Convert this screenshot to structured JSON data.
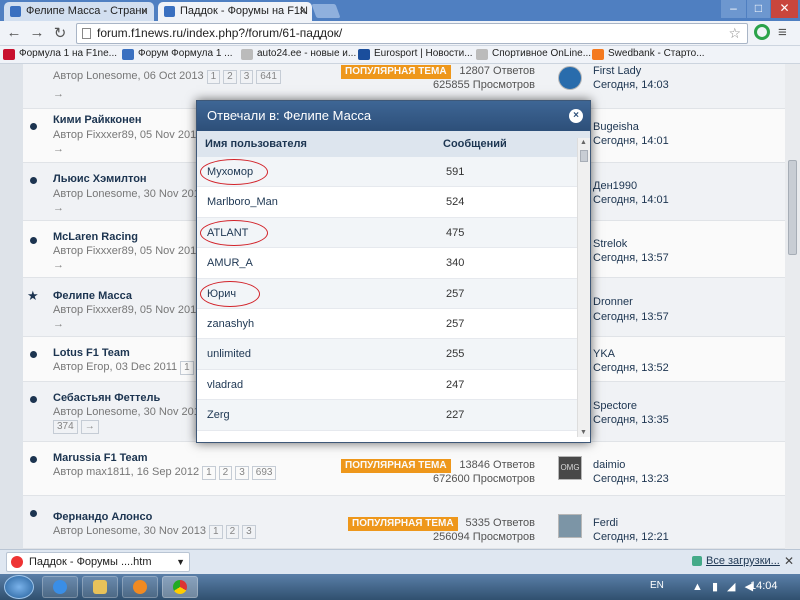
{
  "browser": {
    "tabs": [
      {
        "title": "Фелипе Масса - Страни",
        "active": false
      },
      {
        "title": "Паддок - Форумы на F1N",
        "active": true
      }
    ],
    "window_buttons": {
      "minimize": "–",
      "maximize": "□",
      "close": "✕"
    },
    "nav": {
      "back": "←",
      "forward": "→",
      "reload": "↻"
    },
    "url": "forum.f1news.ru/index.php?/forum/61-паддок/",
    "bookmarks": [
      {
        "label": "Формула 1 на F1ne...",
        "color": "#c8102e"
      },
      {
        "label": "Форум Формула 1 ...",
        "color": "#3a70c0"
      },
      {
        "label": "auto24.ee - новые и...",
        "color": "#999999"
      },
      {
        "label": "Eurosport | Новости...",
        "color": "#1a4e9c"
      },
      {
        "label": "Спортивное OnLine...",
        "color": "#999999"
      },
      {
        "label": "Swedbank - Старто...",
        "color": "#f47a20"
      }
    ]
  },
  "topics": [
    {
      "title": "",
      "author": "Автор Lonesome, 06 Oct 2013",
      "pages": [
        "1",
        "2",
        "3",
        "641"
      ],
      "arrow": "→",
      "popular": "ПОПУЛЯРНАЯ ТЕМА",
      "replies": "12807 Ответов",
      "views": "625855 Просмотров",
      "last_user": "First Lady",
      "last_date": "Сегодня, 14:03"
    },
    {
      "title": "Кими Райкконен",
      "author": "Автор Fixxxer89, 05 Nov 2012",
      "arrow": "→",
      "last_user": "Bugeisha",
      "last_date": "Сегодня, 14:01"
    },
    {
      "title": "Льюис Хэмилтон",
      "author": "Автор Lonesome, 30 Nov 2012",
      "arrow": "→",
      "last_user": "Ден1990",
      "last_date": "Сегодня, 14:01"
    },
    {
      "title": "McLaren Racing",
      "author": "Автор Fixxxer89, 05 Nov 2012",
      "arrow": "→",
      "last_user": "Strelok",
      "last_date": "Сегодня, 13:57"
    },
    {
      "title": "Фелипе Масса",
      "author": "Автор Fixxxer89, 05 Nov 2012",
      "arrow": "→",
      "last_user": "Dronner",
      "last_date": "Сегодня, 13:57"
    },
    {
      "title": "Lotus F1 Team",
      "author": "Автор Егор, 03 Dec 2011",
      "pages": [
        "1"
      ],
      "last_user": "YKA",
      "last_date": "Сегодня, 13:52"
    },
    {
      "title": "Себастьян Феттель",
      "author": "Автор Lonesome, 30 Nov 2012",
      "pages": [
        "374"
      ],
      "arrow": "→",
      "last_user": "Spectore",
      "last_date": "Сегодня, 13:35"
    },
    {
      "title": "Marussia F1 Team",
      "author": "Автор max1811, 16 Sep 2012",
      "pages": [
        "1",
        "2",
        "3",
        "693"
      ],
      "popular": "ПОПУЛЯРНАЯ ТЕМА",
      "replies": "13846 Ответов",
      "views": "672600 Просмотров",
      "avatar_text": "OMG",
      "last_user": "daimio",
      "last_date": "Сегодня, 13:23"
    },
    {
      "title": "Фернандо Алонсо",
      "author": "Автор Lonesome, 30 Nov 2013",
      "pages": [
        "1",
        "2",
        "3"
      ],
      "popular": "ПОПУЛЯРНАЯ ТЕМА",
      "replies": "5335 Ответов",
      "views": "256094 Просмотров",
      "last_user": "Ferdi",
      "last_date": "Сегодня, 12:21"
    }
  ],
  "modal": {
    "title": "Отвечали в: Фелипе Масса",
    "close": "×",
    "col_user": "Имя пользователя",
    "col_posts": "Сообщений",
    "rows": [
      {
        "user": "Мухомор",
        "posts": "591",
        "circled": true
      },
      {
        "user": "Marlboro_Man",
        "posts": "524"
      },
      {
        "user": "ATLANT",
        "posts": "475",
        "circled": true
      },
      {
        "user": "AMUR_A",
        "posts": "340"
      },
      {
        "user": "Юрич",
        "posts": "257",
        "circled": true
      },
      {
        "user": "zanashyh",
        "posts": "257"
      },
      {
        "user": "unlimited",
        "posts": "255"
      },
      {
        "user": "vladrad",
        "posts": "247"
      },
      {
        "user": "Zerg",
        "posts": "227"
      }
    ]
  },
  "downloads": {
    "item": "Паддок - Форумы ....htm",
    "arrow": "▼",
    "all": "Все загрузки...",
    "close": "✕"
  },
  "taskbar": {
    "lang": "EN",
    "tray": "▲ ▮ ◢ ◀",
    "time": "14:04"
  },
  "colors": {
    "accent": "#1d3652",
    "popular": "#f39b1c",
    "modal_header": "#2d4f79",
    "annotation": "#d2232a"
  }
}
